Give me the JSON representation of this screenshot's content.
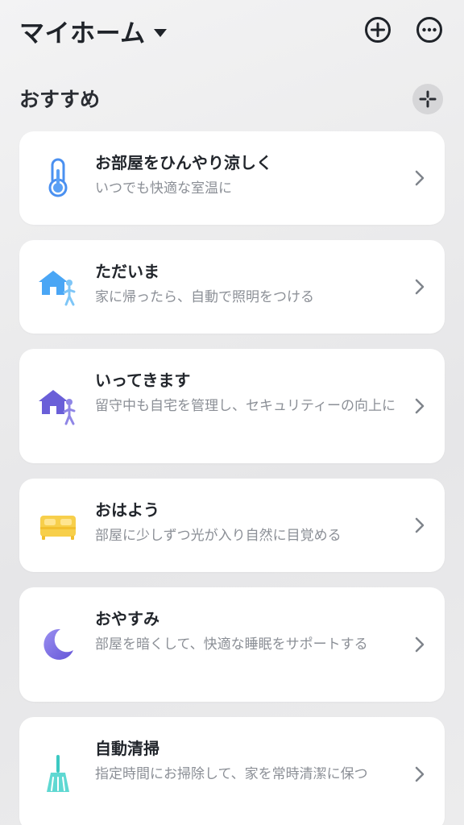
{
  "header": {
    "home_label": "マイホーム"
  },
  "section": {
    "title": "おすすめ"
  },
  "cards": [
    {
      "title": "お部屋をひんやり涼しく",
      "subtitle": "いつでも快適な室温に",
      "icon": "thermometer-icon"
    },
    {
      "title": "ただいま",
      "subtitle": "家に帰ったら、自動で照明をつける",
      "icon": "home-arrive-icon"
    },
    {
      "title": "いってきます",
      "subtitle": "留守中も自宅を管理し、セキュリティーの向上に",
      "icon": "home-leave-icon"
    },
    {
      "title": "おはよう",
      "subtitle": "部屋に少しずつ光が入り自然に目覚める",
      "icon": "bed-icon"
    },
    {
      "title": "おやすみ",
      "subtitle": "部屋を暗くして、快適な睡眠をサポートする",
      "icon": "moon-icon"
    },
    {
      "title": "自動清掃",
      "subtitle": "指定時間にお掃除して、家を常時清潔に保つ",
      "icon": "broom-icon"
    }
  ],
  "colors": {
    "thermometer": "#4a90f0",
    "home_arrive": "#4aa6f5",
    "home_leave": "#6a5fd8",
    "bed": "#f7cf4b",
    "moon": "#7b6ee6",
    "broom": "#3cc9c2"
  }
}
